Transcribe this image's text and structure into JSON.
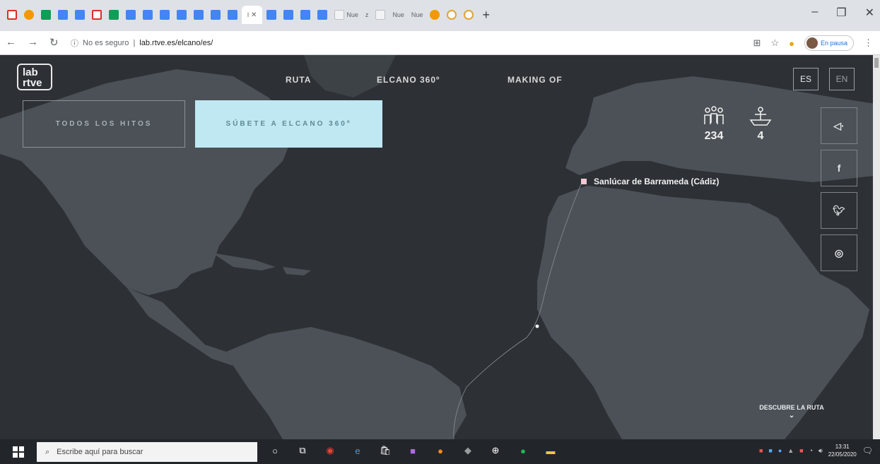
{
  "browser": {
    "active_tab_label": "l",
    "tab_labels": [
      "Nue",
      "z",
      "Nue",
      "Nue"
    ],
    "new_tab": "+",
    "security_label": "No es seguro",
    "url": "lab.rtve.es/elcano/es/",
    "profile_label": "En pausa"
  },
  "site": {
    "logo_line1": "lab",
    "logo_line2": "rtve",
    "menu": [
      "RUTA",
      "ELCANO 360º",
      "MAKING OF"
    ],
    "lang_es": "ES",
    "lang_en": "EN",
    "btn_hitos": "TODOS LOS HITOS",
    "btn_elcano": "SÚBETE A ELCANO 360º",
    "crew_count": "234",
    "ships_count": "4",
    "place": "Sanlúcar de Barrameda (Cádiz)",
    "discover": "DESCUBRE LA RUTA",
    "social": [
      "sound",
      "facebook",
      "twitter",
      "whatsapp"
    ]
  },
  "taskbar": {
    "search_placeholder": "Escribe aquí para buscar",
    "time": "13:31",
    "date": "22/05/2020"
  },
  "colors": {
    "map_bg": "#2d3136",
    "land": "#4b5156",
    "accent_button": "#bfe8f3",
    "marker": "#f4c6d0"
  }
}
